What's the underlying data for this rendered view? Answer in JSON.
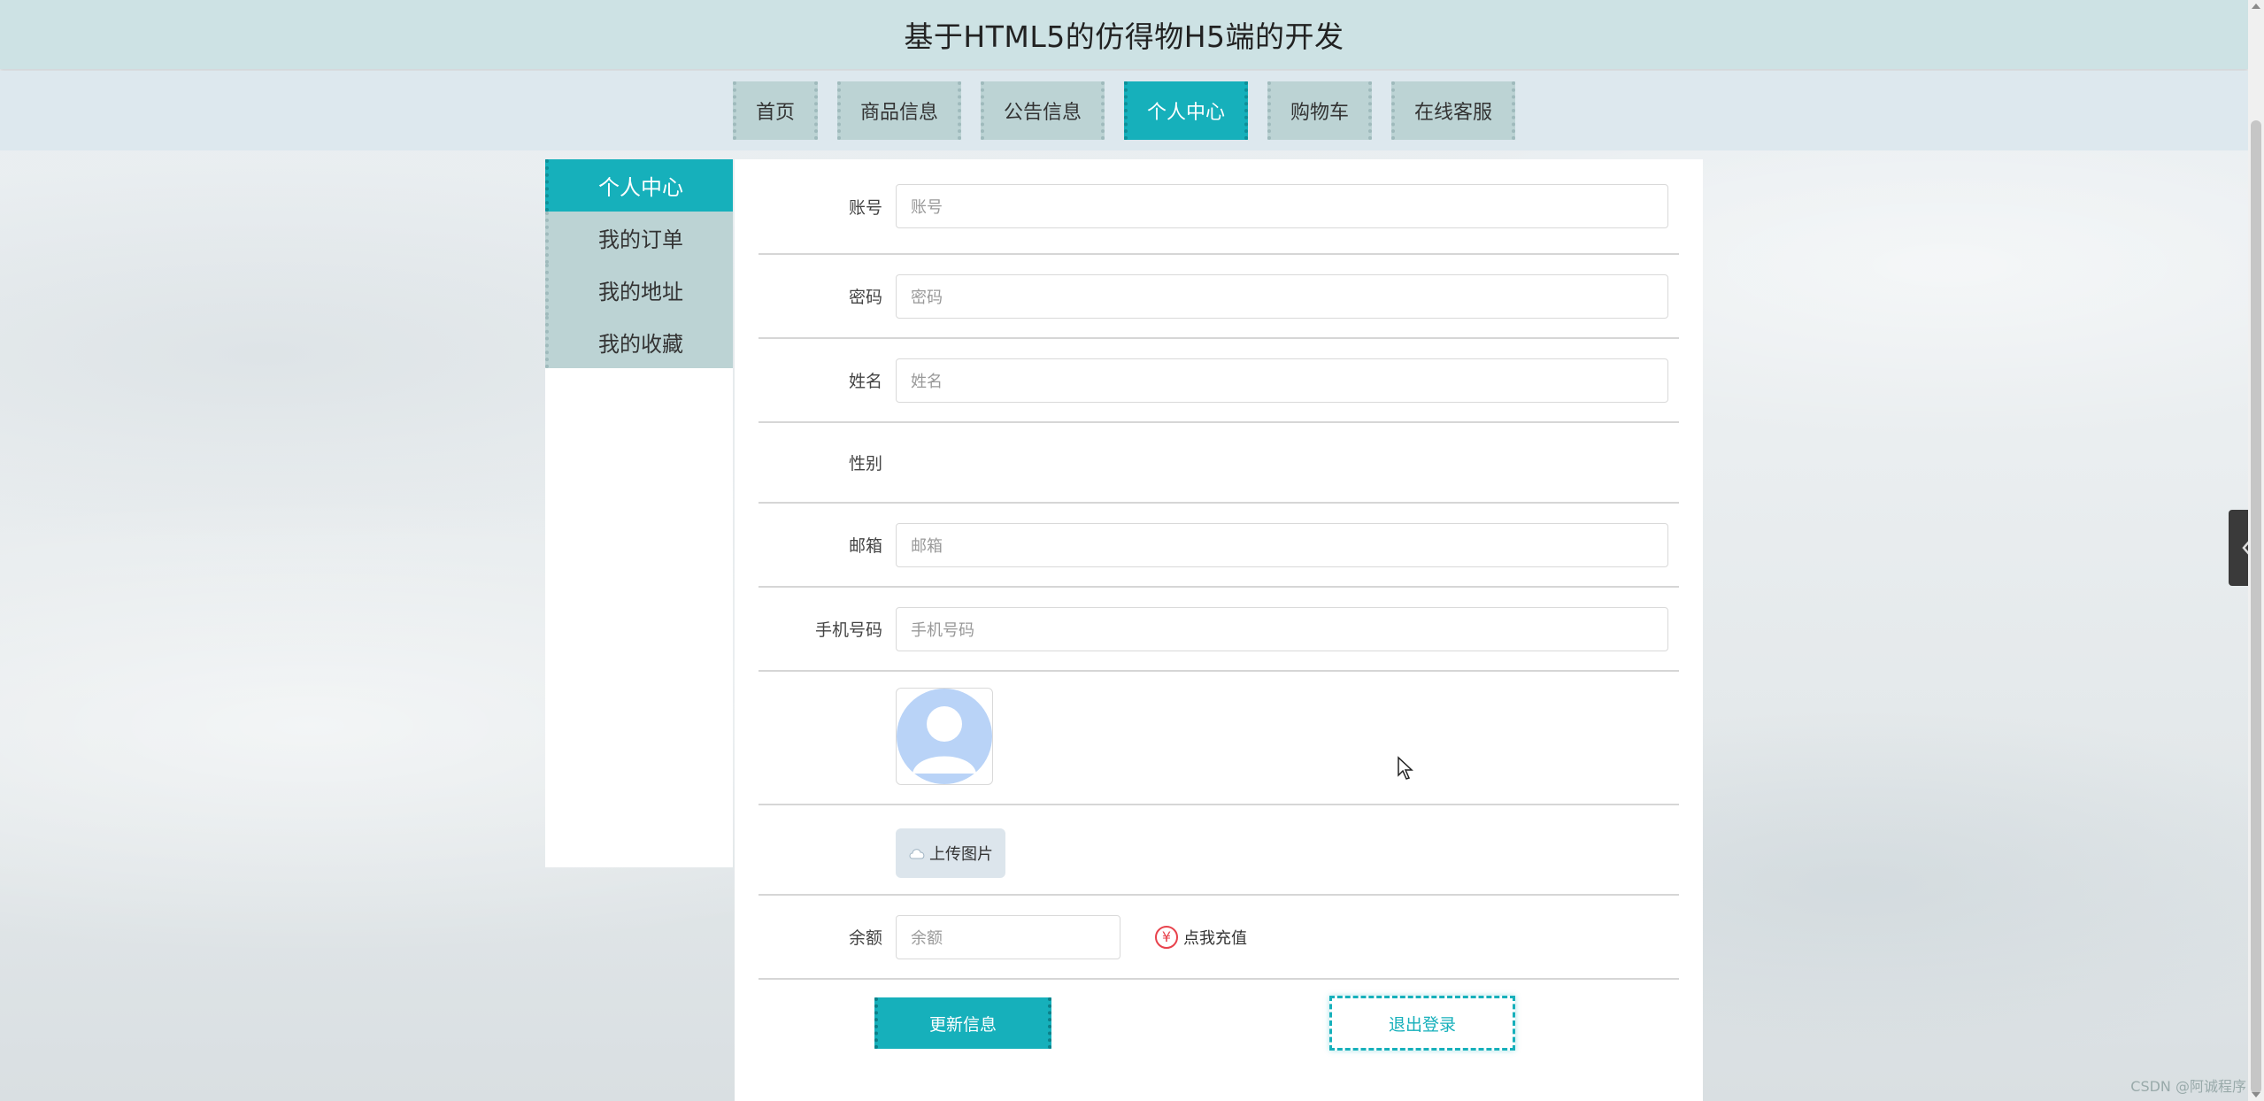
{
  "header": {
    "title": "基于HTML5的仿得物H5端的开发"
  },
  "nav": {
    "items": [
      "首页",
      "商品信息",
      "公告信息",
      "个人中心",
      "购物车",
      "在线客服"
    ],
    "active": "个人中心"
  },
  "sidebar": {
    "items": [
      "个人中心",
      "我的订单",
      "我的地址",
      "我的收藏"
    ],
    "active": "个人中心"
  },
  "form": {
    "account": {
      "label": "账号",
      "placeholder": "账号"
    },
    "password": {
      "label": "密码",
      "placeholder": "密码"
    },
    "name": {
      "label": "姓名",
      "placeholder": "姓名"
    },
    "gender": {
      "label": "性别"
    },
    "email": {
      "label": "邮箱",
      "placeholder": "邮箱"
    },
    "phone": {
      "label": "手机号码",
      "placeholder": "手机号码"
    },
    "upload_label": "上传图片",
    "balance": {
      "label": "余额",
      "placeholder": "余额"
    },
    "recharge_label": "点我充值",
    "update_button": "更新信息",
    "logout_button": "退出登录"
  },
  "watermark": "CSDN @阿诚程序",
  "icons": {
    "avatar": "user-avatar-icon",
    "upload": "cloud-upload-icon",
    "recharge": "yen-icon",
    "toggle": "chevron-left-icon"
  },
  "colors": {
    "accent": "#16b0bb",
    "header_bg": "#cde2e4",
    "tab_bg": "#bcd3d4"
  }
}
